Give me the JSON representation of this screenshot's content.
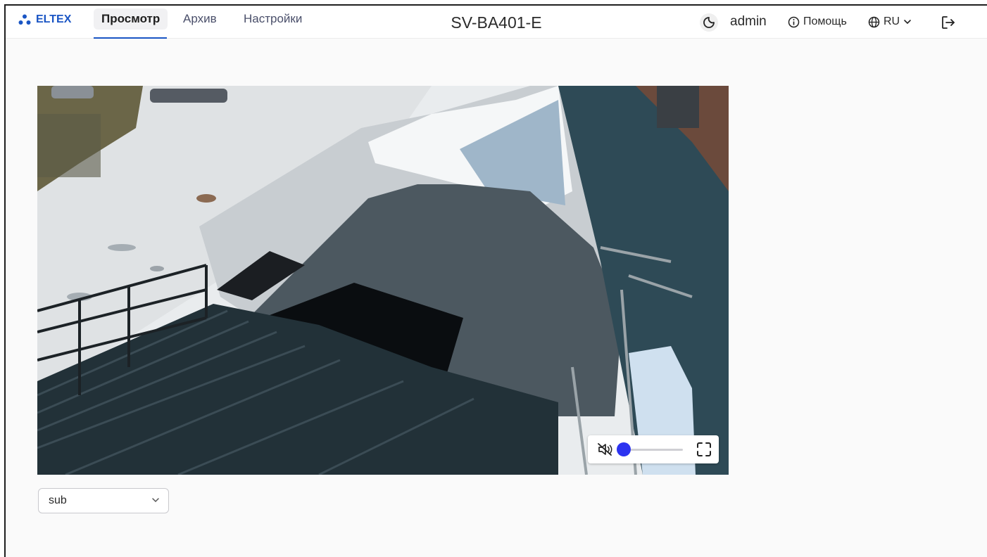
{
  "app": {
    "brand": "ELTEX",
    "device_name": "SV-BA401-E",
    "accent_color": "#1a55c4"
  },
  "nav": {
    "tabs": [
      {
        "label": "Просмотр",
        "active": true
      },
      {
        "label": "Архив",
        "active": false
      },
      {
        "label": "Настройки",
        "active": false
      }
    ]
  },
  "header_right": {
    "theme_icon": "moon-icon",
    "username": "admin",
    "help_label": "Помощь",
    "help_icon": "info-icon",
    "language": "RU",
    "language_icon": "globe-icon",
    "logout_icon": "logout-icon"
  },
  "player": {
    "mute_icon": "muted-speaker-icon",
    "volume_level": 0,
    "fullscreen_icon": "fullscreen-icon",
    "slider_color": "#2c33f0"
  },
  "stream": {
    "selected": "sub"
  }
}
